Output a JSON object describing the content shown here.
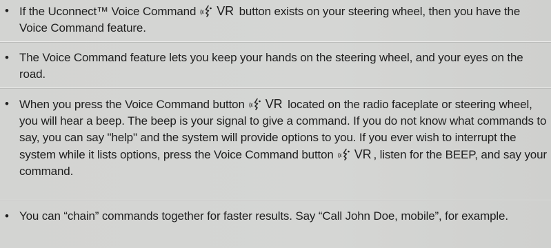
{
  "document": {
    "items": [
      {
        "bullet": "•",
        "text_before": "If the Uconnect™ Voice Command",
        "vr_label": "VR",
        "text_after": "button exists on your steering wheel, then you have the Voice Command feature."
      },
      {
        "bullet": "•",
        "text": "The Voice Command feature lets you keep your hands on the steering wheel, and your eyes on the road."
      },
      {
        "bullet": "•",
        "text_before": "When you press the Voice Command button",
        "vr_label": "VR",
        "text_middle": "located on the radio faceplate or steering wheel, you will hear a beep. The beep is your signal to give a command. If you do not know what commands to say, you can say \"help\" and the system will provide options to you. If you ever wish to interrupt the system while it lists options, press the Voice Command button",
        "vr_label_2": "VR",
        "text_after": ", listen for the BEEP, and say your command."
      },
      {
        "bullet": "•",
        "text": "You can “chain” commands together for faster results. Say “Call John Doe, mobile”, for example."
      }
    ],
    "icon": "voice-command-icon"
  }
}
